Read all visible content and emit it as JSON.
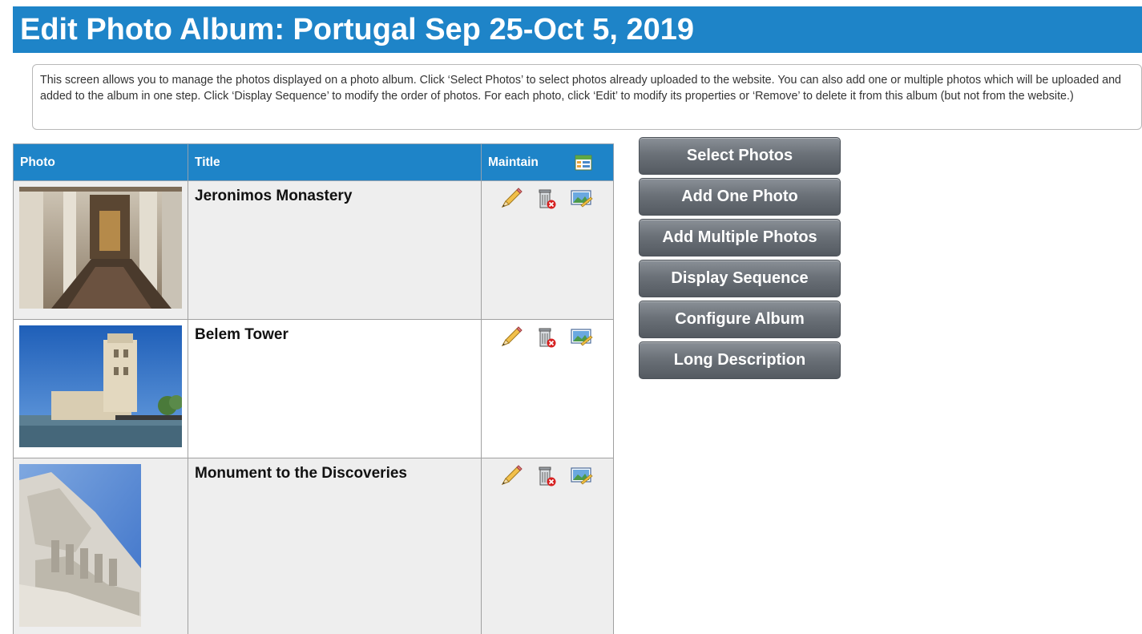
{
  "page": {
    "title": "Edit Photo Album: Portugal Sep 25-Oct 5, 2019",
    "info": "This screen allows you to manage the photos displayed on a photo album. Click ‘Select Photos’ to select photos already uploaded to the website. You can also add one or multiple photos which will be uploaded and added to the album in one step. Click ‘Display Sequence’ to modify the order of photos. For each photo, click ‘Edit’ to modify its properties or ‘Remove’ to delete it from this album (but not from the website.)"
  },
  "table": {
    "headers": {
      "photo": "Photo",
      "title": "Title",
      "maintain": "Maintain"
    },
    "rows": [
      {
        "title": "Jeronimos Monastery",
        "thumb": "monastery"
      },
      {
        "title": "Belem Tower",
        "thumb": "tower"
      },
      {
        "title": "Monument to the Discoveries",
        "thumb": "monument"
      }
    ],
    "icons": [
      "edit-pencil-icon",
      "remove-trash-icon",
      "properties-image-icon"
    ]
  },
  "actions": {
    "select_photos": "Select Photos",
    "add_one_photo": "Add One Photo",
    "add_multiple_photos": "Add Multiple Photos",
    "display_sequence": "Display Sequence",
    "configure_album": "Configure Album",
    "long_description": "Long Description"
  },
  "colors": {
    "header_blue": "#1e84c8",
    "button_gray": "#6b7178"
  }
}
